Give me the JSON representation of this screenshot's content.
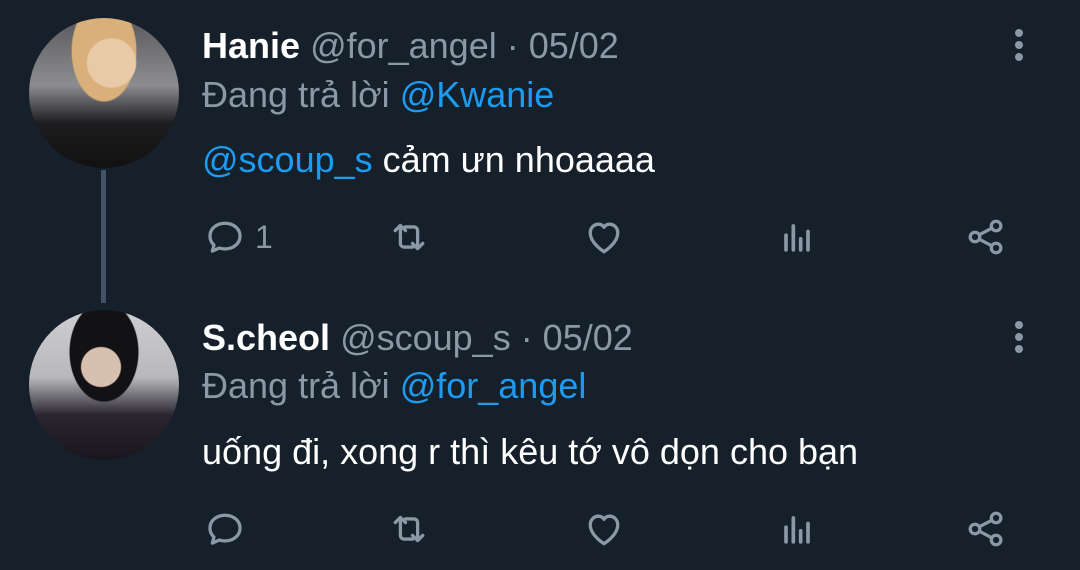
{
  "tweets": [
    {
      "display_name": "Hanie",
      "meta": "@for_angel · 05/02",
      "reply_prefix": "Đang trả lời",
      "reply_to": "@Kwanie",
      "mention": "@scoup_s",
      "text": "cảm ưn nhoaaaa",
      "reply_count": "1",
      "avatar_icon": "user-avatar"
    },
    {
      "display_name": "S.cheol",
      "meta": "@scoup_s · 05/02",
      "reply_prefix": "Đang trả lời",
      "reply_to": "@for_angel",
      "text": "uống đi, xong r thì kêu tớ vô dọn cho bạn",
      "reply_count": "",
      "avatar_icon": "user-avatar"
    }
  ],
  "icons": {
    "reply": "reply-icon",
    "retweet": "retweet-icon",
    "like": "heart-icon",
    "stats": "analytics-icon",
    "share": "share-icon",
    "more": "more-vertical-icon"
  },
  "colors": {
    "background": "#15202b",
    "text": "#ffffff",
    "secondary": "#8b98a5",
    "accent": "#1d9bf0",
    "thread_line": "#425364"
  }
}
